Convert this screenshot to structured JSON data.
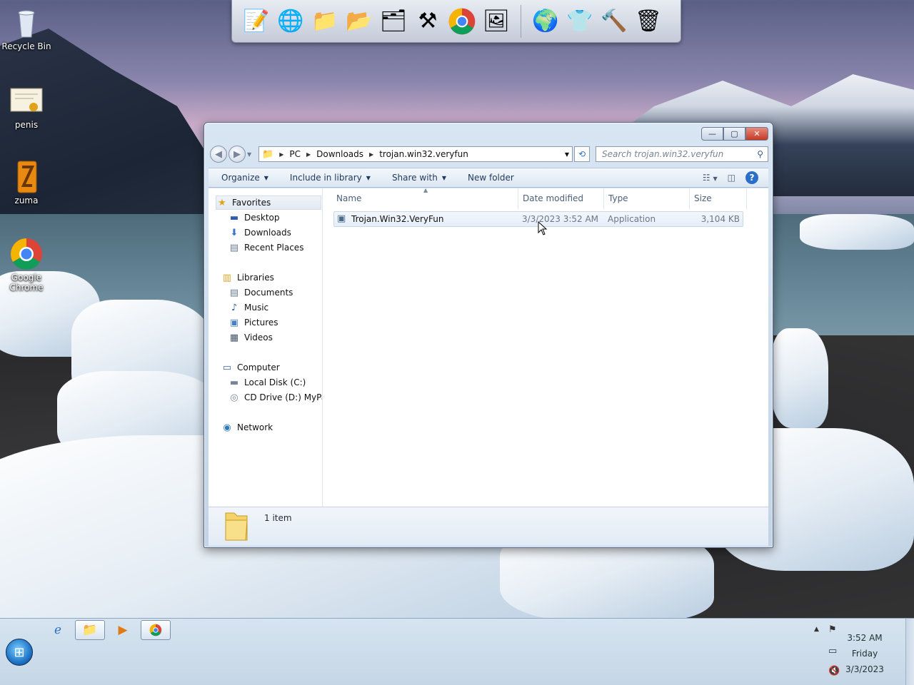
{
  "desktop": {
    "icons": [
      {
        "label": "Recycle Bin",
        "icon": "recycle-bin-icon"
      },
      {
        "label": "penis",
        "icon": "certificate-icon"
      },
      {
        "label": "zuma",
        "icon": "zuma-game-icon"
      },
      {
        "label": "Google Chrome",
        "icon": "chrome-icon"
      }
    ]
  },
  "dock": {
    "items": [
      "notepad-icon",
      "globe-network-icon",
      "folder-icon",
      "folder-music-icon",
      "folder-pictures-icon",
      "tools-icon",
      "chrome-icon",
      "presentation-icon",
      "internet-globe-icon",
      "tshirt-icon",
      "hammer-wrench-icon",
      "recycle-bin-icon"
    ]
  },
  "window": {
    "caption": {
      "minimize": "—",
      "maximize": "▢",
      "close": "✕"
    },
    "address": {
      "breadcrumbs": [
        "PC",
        "Downloads",
        "trojan.win32.veryfun"
      ]
    },
    "search": {
      "placeholder": "Search trojan.win32.veryfun"
    },
    "toolbar": {
      "organize": "Organize",
      "include_in_library": "Include in library",
      "share_with": "Share with",
      "new_folder": "New folder"
    },
    "nav": {
      "favorites": "Favorites",
      "desktop": "Desktop",
      "downloads": "Downloads",
      "recent_places": "Recent Places",
      "libraries": "Libraries",
      "documents": "Documents",
      "music": "Music",
      "pictures": "Pictures",
      "videos": "Videos",
      "computer": "Computer",
      "local_disk": "Local Disk (C:)",
      "cd_drive": "CD Drive (D:) MyPalt",
      "network": "Network"
    },
    "columns": {
      "name": "Name",
      "date_modified": "Date modified",
      "type": "Type",
      "size": "Size"
    },
    "files": [
      {
        "name": "Trojan.Win32.VeryFun",
        "date_modified": "3/3/2023 3:52 AM",
        "type": "Application",
        "size": "3,104 KB"
      }
    ],
    "details": {
      "count": "1 item"
    }
  },
  "taskbar": {
    "clock": {
      "time": "3:52 AM",
      "day": "Friday",
      "date": "3/3/2023"
    }
  }
}
